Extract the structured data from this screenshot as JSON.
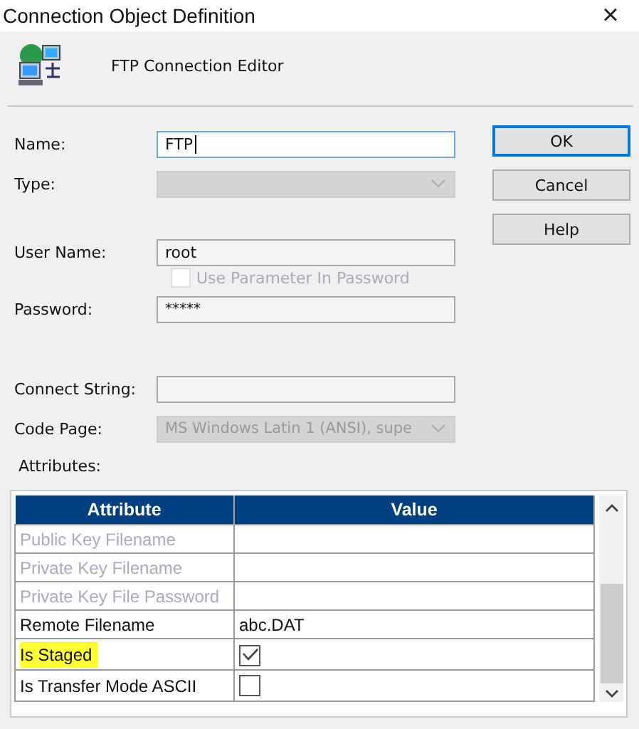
{
  "window": {
    "title": "Connection Object Definition",
    "close": "×"
  },
  "header": {
    "title": "FTP Connection Editor"
  },
  "fields": {
    "name": {
      "label": "Name:",
      "value": "FTP"
    },
    "type": {
      "label": "Type:",
      "disabled": true
    },
    "user_name": {
      "label": "User Name:",
      "value": "root"
    },
    "use_parameter": {
      "label": "Use Parameter In Password",
      "checked": false,
      "disabled": true
    },
    "password": {
      "label": "Password:",
      "value": "*****"
    },
    "connect_string": {
      "label": "Connect String:"
    },
    "code_page": {
      "label": "Code Page:",
      "value": "MS Windows Latin 1 (ANSI), supe",
      "disabled": true
    }
  },
  "buttons": [
    {
      "label": "OK",
      "default": true
    },
    {
      "label": "Cancel",
      "default": false
    },
    {
      "label": "Help",
      "default": false
    }
  ],
  "attributes": {
    "label": "Attributes:",
    "columns": [
      "Attribute",
      "Value"
    ],
    "rows": [
      {
        "attribute": "Public Key Filename",
        "kind": "text",
        "disabled": true,
        "highlighted": false
      },
      {
        "attribute": "Private Key Filename",
        "kind": "text",
        "disabled": true,
        "highlighted": false
      },
      {
        "attribute": "Private Key File Password",
        "kind": "text",
        "disabled": true,
        "highlighted": false
      },
      {
        "attribute": "Remote Filename",
        "kind": "text",
        "value": "abc.DAT",
        "disabled": false,
        "highlighted": false
      },
      {
        "attribute": "Is Staged",
        "kind": "checkbox",
        "checked": true,
        "disabled": false,
        "highlighted": true
      },
      {
        "attribute": "Is Transfer Mode ASCII",
        "kind": "checkbox",
        "checked": false,
        "disabled": false,
        "highlighted": false
      }
    ]
  }
}
